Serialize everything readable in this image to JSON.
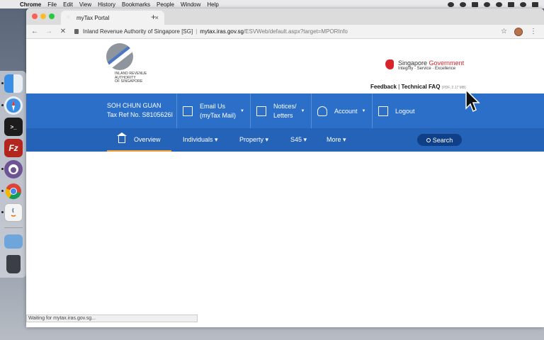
{
  "menubar": {
    "app": "Chrome",
    "items": [
      "File",
      "Edit",
      "View",
      "History",
      "Bookmarks",
      "People",
      "Window",
      "Help"
    ]
  },
  "browser": {
    "tab_title": "myTax Portal",
    "new_tab": "+",
    "tab_close": "×",
    "site_name": "Inland Revenue Authority of Singapore [SG]",
    "url_domain": "mytax.iras.gov.sg",
    "url_path": "/ESVWeb/default.aspx?target=MPORInfo",
    "nav": {
      "back": "←",
      "forward": "→",
      "stop": "✕",
      "star": "☆",
      "menu": "⋮"
    },
    "status": "Waiting for mytax.iras.gov.sg..."
  },
  "header": {
    "logo_text": [
      "INLAND REVENUE",
      "AUTHORITY",
      "OF SINGAPORE"
    ],
    "sg_title_a": "Singapore ",
    "sg_title_b": "Government",
    "sg_tagline": "Integrity · Service · Excellence",
    "feedback": "Feedback",
    "divider": "|",
    "technical_faq": "Technical FAQ",
    "faq_note": "(PDF, 2.17 MB)"
  },
  "topbar": {
    "user_name": "SOH CHUN GUAN",
    "tax_ref": "Tax Ref No. S8105626I",
    "email_line1": "Email Us",
    "email_line2": "(myTax Mail)",
    "notices_line1": "Notices/",
    "notices_line2": "Letters",
    "account": "Account",
    "logout": "Logout",
    "dropdown_arrow": "▼"
  },
  "subnav": {
    "overview": "Overview",
    "individuals": "Individuals ▾",
    "property": "Property ▾",
    "s45": "S45 ▾",
    "more": "More ▾",
    "search": "Search"
  },
  "colors": {
    "topbar": "#2b6fc9",
    "subnav": "#2563b8",
    "active_underline": "#f29b33",
    "search_button": "#0f3f86",
    "sg_red": "#d8232a"
  }
}
